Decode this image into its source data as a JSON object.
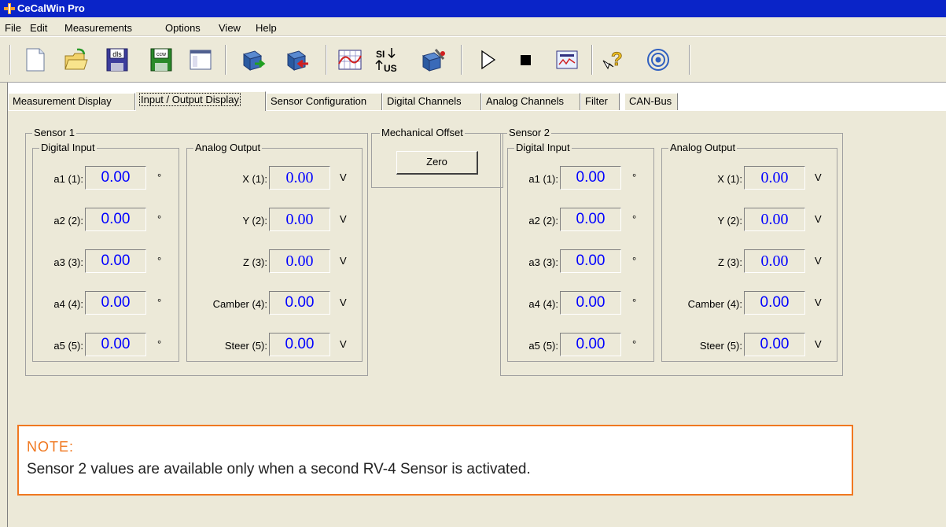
{
  "window": {
    "title": "CeCalWin Pro"
  },
  "menu": [
    "File",
    "Edit",
    "Measurements",
    "Options",
    "View",
    "Help"
  ],
  "toolbar": [
    {
      "name": "new-icon"
    },
    {
      "name": "open-icon"
    },
    {
      "name": "save-dls-icon",
      "label": "dls"
    },
    {
      "name": "save-ccw-icon",
      "label": "ccw"
    },
    {
      "name": "view-icon"
    },
    {
      "name": "export-icon"
    },
    {
      "name": "import-icon"
    },
    {
      "name": "chart-icon"
    },
    {
      "name": "units-si-us-icon",
      "label": "SI US"
    },
    {
      "name": "settings-icon"
    },
    {
      "name": "play-icon"
    },
    {
      "name": "stop-icon"
    },
    {
      "name": "monitor-icon"
    },
    {
      "name": "help-icon"
    },
    {
      "name": "about-icon"
    }
  ],
  "tabs": [
    {
      "label": "Measurement Display"
    },
    {
      "label": "Input / Output Display",
      "active": true
    },
    {
      "label": "Sensor Configuration"
    },
    {
      "label": "Digital Channels"
    },
    {
      "label": "Analog Channels"
    },
    {
      "label": "Filter"
    },
    {
      "label": "CAN-Bus"
    }
  ],
  "sensor1": {
    "title": "Sensor 1",
    "digital": {
      "title": "Digital Input",
      "rows": [
        {
          "label": "a1 (1):",
          "value": "0.00",
          "unit": "°"
        },
        {
          "label": "a2 (2):",
          "value": "0.00",
          "unit": "°"
        },
        {
          "label": "a3 (3):",
          "value": "0.00",
          "unit": "°"
        },
        {
          "label": "a4 (4):",
          "value": "0.00",
          "unit": "°"
        },
        {
          "label": "a5 (5):",
          "value": "0.00",
          "unit": "°"
        }
      ]
    },
    "analog": {
      "title": "Analog Output",
      "rows": [
        {
          "label": "X (1):",
          "value": "0.00",
          "unit": "V"
        },
        {
          "label": "Y (2):",
          "value": "0.00",
          "unit": "V"
        },
        {
          "label": "Z (3):",
          "value": "0.00",
          "unit": "V"
        },
        {
          "label": "Camber (4):",
          "value": "0.00",
          "unit": "V"
        },
        {
          "label": "Steer (5):",
          "value": "0.00",
          "unit": "V"
        }
      ]
    }
  },
  "mechanical_offset": {
    "title": "Mechanical Offset",
    "button": "Zero"
  },
  "sensor2": {
    "title": "Sensor 2",
    "digital": {
      "title": "Digital Input",
      "rows": [
        {
          "label": "a1 (1):",
          "value": "0.00",
          "unit": "°"
        },
        {
          "label": "a2 (2):",
          "value": "0.00",
          "unit": "°"
        },
        {
          "label": "a3 (3):",
          "value": "0.00",
          "unit": "°"
        },
        {
          "label": "a4 (4):",
          "value": "0.00",
          "unit": "°"
        },
        {
          "label": "a5 (5):",
          "value": "0.00",
          "unit": "°"
        }
      ]
    },
    "analog": {
      "title": "Analog Output",
      "rows": [
        {
          "label": "X (1):",
          "value": "0.00",
          "unit": "V"
        },
        {
          "label": "Y (2):",
          "value": "0.00",
          "unit": "V"
        },
        {
          "label": "Z (3):",
          "value": "0.00",
          "unit": "V"
        },
        {
          "label": "Camber (4):",
          "value": "0.00",
          "unit": "V"
        },
        {
          "label": "Steer (5):",
          "value": "0.00",
          "unit": "V"
        }
      ]
    }
  },
  "note": {
    "title": "NOTE:",
    "text": "Sensor 2 values are available only when a second RV-4 Sensor is activated."
  }
}
